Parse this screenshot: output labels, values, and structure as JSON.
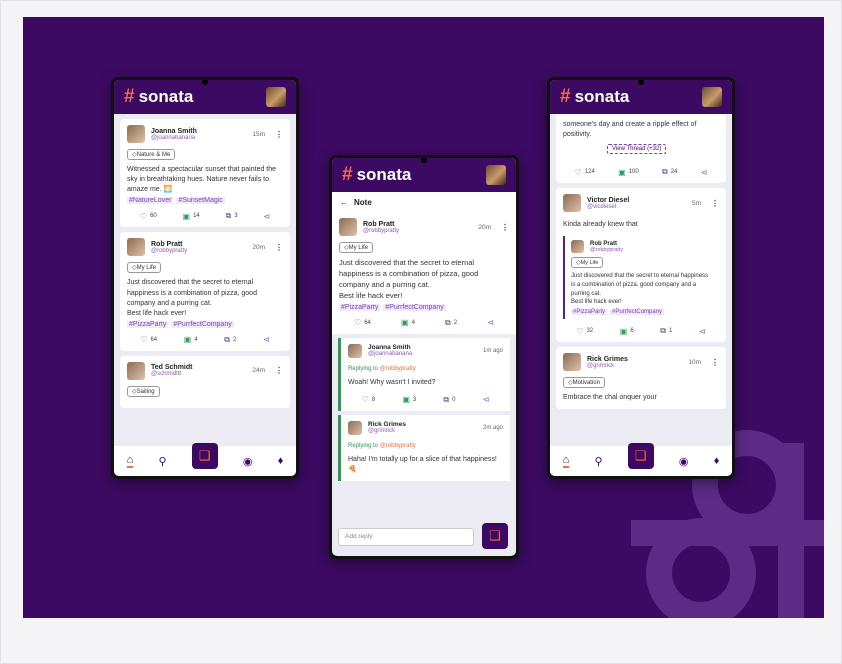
{
  "brand": {
    "name": "sonata",
    "hash": "#"
  },
  "phone1": {
    "post1": {
      "name": "Joanna Smith",
      "handle": "@joannabanana",
      "time": "15m",
      "tag": "Nature & Me",
      "text": "Witnessed a spectacular sunset that painted the sky in breathtaking hues. Nature never fails to amaze me. 🌅",
      "hashtags": [
        "#NatureLover",
        "#SunsetMagic"
      ],
      "likes": "60",
      "comments": "14",
      "reposts": "3"
    },
    "post2": {
      "name": "Rob Pratt",
      "handle": "@robbypratty",
      "time": "20m",
      "tag": "My Life",
      "text": "Just discovered that the secret to eternal happiness is a combination of pizza, good company and a purring cat.",
      "text2": "Best life hack ever!",
      "hashtags": [
        "#PizzaParty",
        "#PurrfectCompany"
      ],
      "likes": "64",
      "comments": "4",
      "reposts": "2"
    },
    "post3": {
      "name": "Ted Schmidt",
      "handle": "@schmidttt",
      "time": "24m",
      "tag": "Sailing"
    }
  },
  "phone2": {
    "title": "Note",
    "post": {
      "name": "Rob Pratt",
      "handle": "@robbypratty",
      "time": "20m",
      "tag": "My Life",
      "text": "Just discovered that the secret to eternal happiness is a combination of pizza, good company and a purring cat.",
      "text2": "Best life hack ever!",
      "hashtags": [
        "#PizzaParty",
        "#PurrfectCompany"
      ],
      "likes": "64",
      "comments": "4",
      "reposts": "2"
    },
    "reply1": {
      "name": "Joanna Smith",
      "handle": "@joannabanana",
      "time": "1m ago",
      "reply_prefix": "Replying to",
      "reply_to": "@robbypratty",
      "text": "Woah! Why wasn't I invited?",
      "likes": "8",
      "comments": "3",
      "reposts": "0"
    },
    "reply2": {
      "name": "Rick Grimes",
      "handle": "@grimrick",
      "time": "2m ago",
      "reply_prefix": "Replying to",
      "reply_to": "@robbypratty",
      "text": "Haha! I'm totally up for a slice of that happiness! 🍕"
    },
    "add_reply_placeholder": "Add reply"
  },
  "phone3": {
    "top_text": "someone's day and create a ripple effect of positivity.",
    "thread_label": "View Thread",
    "thread_count": "(+32)",
    "top_likes": "124",
    "top_comments": "100",
    "top_reposts": "24",
    "post1": {
      "name": "Victor Diesel",
      "handle": "@vicdiesel",
      "time": "5m",
      "text": "Kinda already knew that",
      "likes": "32",
      "comments": "6",
      "reposts": "1"
    },
    "quoted": {
      "name": "Rob Pratt",
      "handle": "@robbypratty",
      "tag": "My Life",
      "text": "Just discovered that the secret to eternal happiness is a combination of pizza, good company and a purring cat.",
      "text2": "Best life hack ever!",
      "hashtags": [
        "#PizzaParty",
        "#PurrfectCompany"
      ]
    },
    "post2": {
      "name": "Rick Grimes",
      "handle": "@grimrick",
      "time": "10m",
      "tag": "Motivation",
      "text": "Embrace the chal    onquer your"
    }
  },
  "colors": {
    "brand": "#3d0a63",
    "accent": "#ff6a3d",
    "like": "#e0443b",
    "comment": "#2c9b55"
  }
}
